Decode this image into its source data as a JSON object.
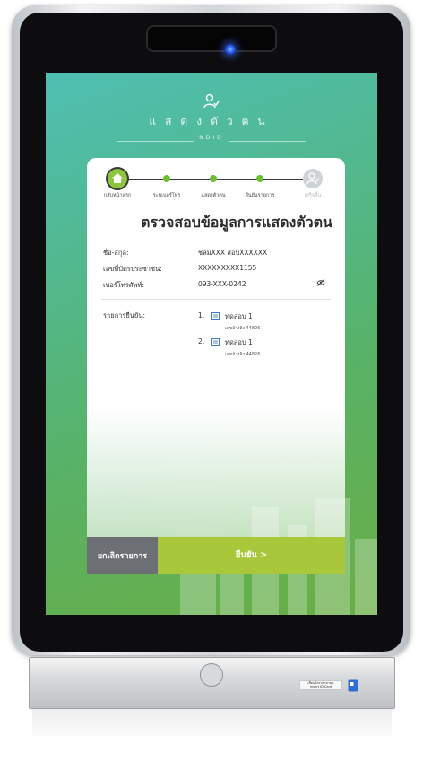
{
  "header": {
    "title": "แสดงตัวตน",
    "subtitle": "NDID",
    "icon": "user-check-icon"
  },
  "stepper": {
    "steps": [
      {
        "label": "กลับหน้าแรก",
        "state": "active",
        "icon": "home-icon"
      },
      {
        "label": "ระบุเบอร์โทร",
        "state": "done"
      },
      {
        "label": "แสดงตัวตน",
        "state": "done"
      },
      {
        "label": "ยืนยันรายการ",
        "state": "done"
      },
      {
        "label": "เสร็จสิ้น",
        "state": "pending",
        "icon": "user-check-icon"
      }
    ]
  },
  "card": {
    "title": "ตรวจสอบข้อมูลการแสดงตัวตน",
    "fields": [
      {
        "label": "ชื่อ-สกุล:",
        "value": "ชลมXXX สอบXXXXXX"
      },
      {
        "label": "เลขที่บัตรประชาชน:",
        "value": "XXXXXXXXX1155"
      },
      {
        "label": "เบอร์โทรศัพท์:",
        "value": "093-XXX-0242"
      }
    ],
    "items_label": "รายการยืนยัน:",
    "items": [
      {
        "number": "1.",
        "name": "ทดสอบ 1",
        "detail": "เลขอ้างอิง 44826"
      },
      {
        "number": "2.",
        "name": "ทดสอบ 1",
        "detail": "เลขอ้างอิง 44826"
      }
    ]
  },
  "buttons": {
    "cancel": "ยกเลิกรายการ",
    "confirm": "ยืนยัน >"
  },
  "hardware": {
    "card_slot_label_line1": "เสียบบัตรประชาชน",
    "card_slot_label_line2": "Insert ID Card"
  },
  "colors": {
    "accent": "#a9c73a",
    "step_active": "#8cc63e",
    "cancel": "#6c7075",
    "led": "#1f4fe0"
  }
}
